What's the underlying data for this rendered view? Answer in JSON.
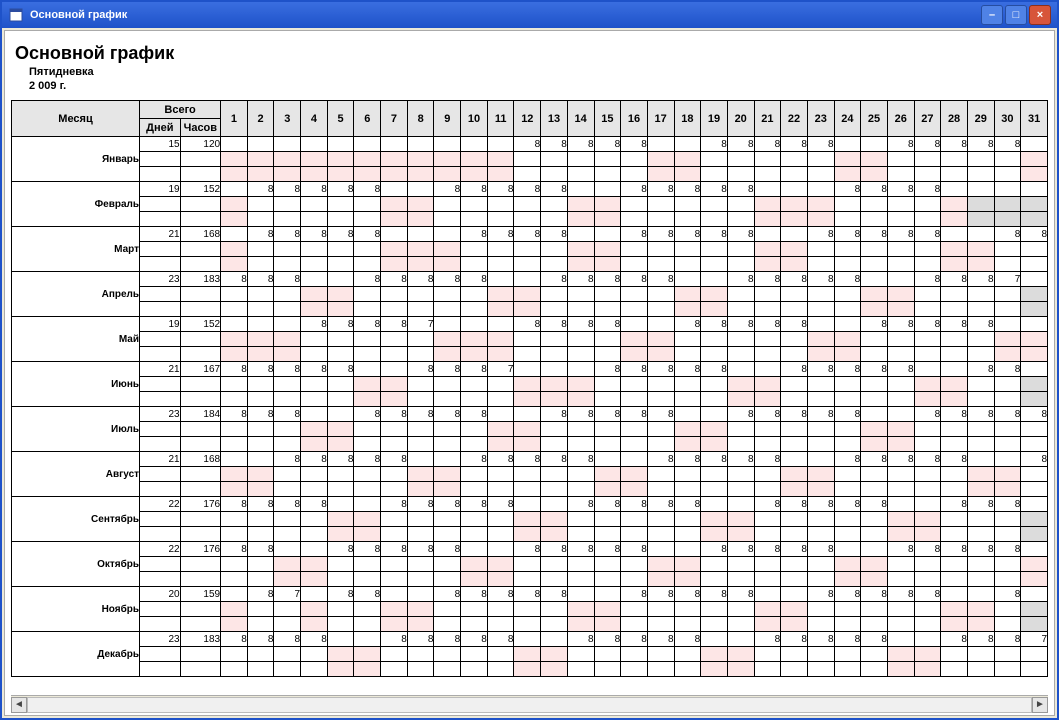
{
  "window": {
    "title": "Основной график"
  },
  "header": {
    "title": "Основной график",
    "subtype": "Пятидневка",
    "year": "2 009 г."
  },
  "columns": {
    "month": "Месяц",
    "total": "Всего",
    "days_label": "Дней",
    "hours_label": "Часов",
    "day_numbers": [
      "1",
      "2",
      "3",
      "4",
      "5",
      "6",
      "7",
      "8",
      "9",
      "10",
      "11",
      "12",
      "13",
      "14",
      "15",
      "16",
      "17",
      "18",
      "19",
      "20",
      "21",
      "22",
      "23",
      "24",
      "25",
      "26",
      "27",
      "28",
      "29",
      "30",
      "31"
    ]
  },
  "months": [
    {
      "name": "Январь",
      "days": "15",
      "hours": "120",
      "weekend": [
        1,
        2,
        3,
        4,
        5,
        6,
        7,
        8,
        9,
        10,
        11,
        17,
        18,
        24,
        25,
        31
      ],
      "cells": {
        "12": "8",
        "13": "8",
        "14": "8",
        "15": "8",
        "16": "8",
        "19": "8",
        "20": "8",
        "21": "8",
        "22": "8",
        "23": "8",
        "26": "8",
        "27": "8",
        "28": "8",
        "29": "8",
        "30": "8"
      }
    },
    {
      "name": "Февраль",
      "days": "19",
      "hours": "152",
      "weekend": [
        1,
        7,
        8,
        14,
        15,
        21,
        22,
        23,
        28
      ],
      "invalid": [
        29,
        30,
        31
      ],
      "cells": {
        "2": "8",
        "3": "8",
        "4": "8",
        "5": "8",
        "6": "8",
        "9": "8",
        "10": "8",
        "11": "8",
        "12": "8",
        "13": "8",
        "16": "8",
        "17": "8",
        "18": "8",
        "19": "8",
        "20": "8",
        "24": "8",
        "25": "8",
        "26": "8",
        "27": "8"
      }
    },
    {
      "name": "Март",
      "days": "21",
      "hours": "168",
      "weekend": [
        1,
        7,
        8,
        9,
        14,
        15,
        21,
        22,
        28,
        29
      ],
      "cells": {
        "2": "8",
        "3": "8",
        "4": "8",
        "5": "8",
        "6": "8",
        "10": "8",
        "11": "8",
        "12": "8",
        "13": "8",
        "16": "8",
        "17": "8",
        "18": "8",
        "19": "8",
        "20": "8",
        "23": "8",
        "24": "8",
        "25": "8",
        "26": "8",
        "27": "8",
        "30": "8",
        "31": "8"
      }
    },
    {
      "name": "Апрель",
      "days": "23",
      "hours": "183",
      "weekend": [
        4,
        5,
        11,
        12,
        18,
        19,
        25,
        26
      ],
      "invalid": [
        31
      ],
      "cells": {
        "1": "8",
        "2": "8",
        "3": "8",
        "6": "8",
        "7": "8",
        "8": "8",
        "9": "8",
        "10": "8",
        "13": "8",
        "14": "8",
        "15": "8",
        "16": "8",
        "17": "8",
        "20": "8",
        "21": "8",
        "22": "8",
        "23": "8",
        "24": "8",
        "27": "8",
        "28": "8",
        "29": "8",
        "30": "7"
      }
    },
    {
      "name": "Май",
      "days": "19",
      "hours": "152",
      "weekend": [
        1,
        2,
        3,
        9,
        10,
        11,
        16,
        17,
        23,
        24,
        30,
        31
      ],
      "cells": {
        "4": "8",
        "5": "8",
        "6": "8",
        "7": "8",
        "8": "7",
        "12": "8",
        "13": "8",
        "14": "8",
        "15": "8",
        "18": "8",
        "19": "8",
        "20": "8",
        "21": "8",
        "22": "8",
        "25": "8",
        "26": "8",
        "27": "8",
        "28": "8",
        "29": "8"
      }
    },
    {
      "name": "Июнь",
      "days": "21",
      "hours": "167",
      "weekend": [
        6,
        7,
        12,
        13,
        14,
        20,
        21,
        27,
        28
      ],
      "invalid": [
        31
      ],
      "cells": {
        "1": "8",
        "2": "8",
        "3": "8",
        "4": "8",
        "5": "8",
        "8": "8",
        "9": "8",
        "10": "8",
        "11": "7",
        "15": "8",
        "16": "8",
        "17": "8",
        "18": "8",
        "19": "8",
        "22": "8",
        "23": "8",
        "24": "8",
        "25": "8",
        "26": "8",
        "29": "8",
        "30": "8"
      }
    },
    {
      "name": "Июль",
      "days": "23",
      "hours": "184",
      "weekend": [
        4,
        5,
        11,
        12,
        18,
        19,
        25,
        26
      ],
      "cells": {
        "1": "8",
        "2": "8",
        "3": "8",
        "6": "8",
        "7": "8",
        "8": "8",
        "9": "8",
        "10": "8",
        "13": "8",
        "14": "8",
        "15": "8",
        "16": "8",
        "17": "8",
        "20": "8",
        "21": "8",
        "22": "8",
        "23": "8",
        "24": "8",
        "27": "8",
        "28": "8",
        "29": "8",
        "30": "8",
        "31": "8"
      }
    },
    {
      "name": "Август",
      "days": "21",
      "hours": "168",
      "weekend": [
        1,
        2,
        8,
        9,
        15,
        16,
        22,
        23,
        29,
        30
      ],
      "cells": {
        "3": "8",
        "4": "8",
        "5": "8",
        "6": "8",
        "7": "8",
        "10": "8",
        "11": "8",
        "12": "8",
        "13": "8",
        "14": "8",
        "17": "8",
        "18": "8",
        "19": "8",
        "20": "8",
        "21": "8",
        "24": "8",
        "25": "8",
        "26": "8",
        "27": "8",
        "28": "8",
        "31": "8"
      }
    },
    {
      "name": "Сентябрь",
      "days": "22",
      "hours": "176",
      "weekend": [
        5,
        6,
        12,
        13,
        19,
        20,
        26,
        27
      ],
      "invalid": [
        31
      ],
      "cells": {
        "1": "8",
        "2": "8",
        "3": "8",
        "4": "8",
        "7": "8",
        "8": "8",
        "9": "8",
        "10": "8",
        "11": "8",
        "14": "8",
        "15": "8",
        "16": "8",
        "17": "8",
        "18": "8",
        "21": "8",
        "22": "8",
        "23": "8",
        "24": "8",
        "25": "8",
        "28": "8",
        "29": "8",
        "30": "8"
      }
    },
    {
      "name": "Октябрь",
      "days": "22",
      "hours": "176",
      "weekend": [
        3,
        4,
        10,
        11,
        17,
        18,
        24,
        25,
        31
      ],
      "cells": {
        "1": "8",
        "2": "8",
        "5": "8",
        "6": "8",
        "7": "8",
        "8": "8",
        "9": "8",
        "12": "8",
        "13": "8",
        "14": "8",
        "15": "8",
        "16": "8",
        "19": "8",
        "20": "8",
        "21": "8",
        "22": "8",
        "23": "8",
        "26": "8",
        "27": "8",
        "28": "8",
        "29": "8",
        "30": "8"
      }
    },
    {
      "name": "Ноябрь",
      "days": "20",
      "hours": "159",
      "weekend": [
        1,
        4,
        7,
        8,
        14,
        15,
        21,
        22,
        28,
        29
      ],
      "invalid": [
        31
      ],
      "cells": {
        "2": "8",
        "3": "7",
        "5": "8",
        "6": "8",
        "9": "8",
        "10": "8",
        "11": "8",
        "12": "8",
        "13": "8",
        "16": "8",
        "17": "8",
        "18": "8",
        "19": "8",
        "20": "8",
        "23": "8",
        "24": "8",
        "25": "8",
        "26": "8",
        "27": "8",
        "30": "8"
      }
    },
    {
      "name": "Декабрь",
      "days": "23",
      "hours": "183",
      "weekend": [
        5,
        6,
        12,
        13,
        19,
        20,
        26,
        27
      ],
      "cells": {
        "1": "8",
        "2": "8",
        "3": "8",
        "4": "8",
        "7": "8",
        "8": "8",
        "9": "8",
        "10": "8",
        "11": "8",
        "14": "8",
        "15": "8",
        "16": "8",
        "17": "8",
        "18": "8",
        "21": "8",
        "22": "8",
        "23": "8",
        "24": "8",
        "25": "8",
        "28": "8",
        "29": "8",
        "30": "8",
        "31": "7"
      }
    }
  ]
}
